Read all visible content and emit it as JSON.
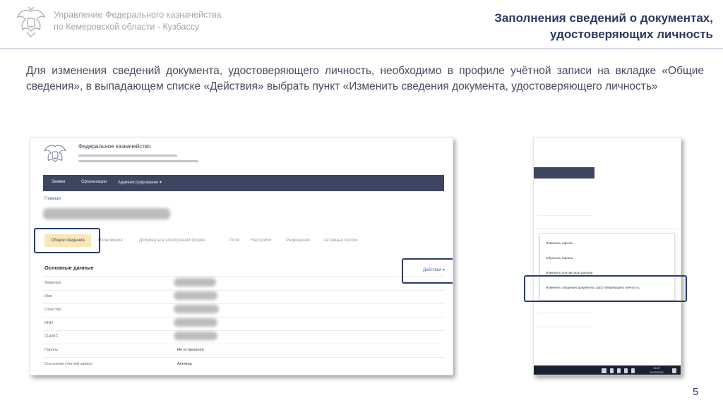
{
  "header": {
    "org_line1": "Управление Федерального казначейства",
    "org_line2": "по Кемеровской области - Кузбассу",
    "title_line1": "Заполнения сведений о документах,",
    "title_line2": "удостоверяющих личность"
  },
  "body_text": "Для изменения сведений документа, удостоверяющего личность, необходимо в профиле учётной записи на вкладке «Общие сведения», в выпадающем списке «Действия» выбрать пункт  «Изменить сведения документа, удостоверяющего личность»",
  "screenshot1": {
    "brand": "Федеральное казначейство",
    "nav": [
      "Заявки",
      "Организации",
      "Администрирование ▾"
    ],
    "breadcrumb": "Главная",
    "tabs": [
      "Общие сведения",
      "Полномочия",
      "Документы в электронной форме",
      "Роли",
      "Настройки",
      "Разрешения",
      "Активные сессии"
    ],
    "section_title": "Основные данные",
    "actions_label": "Действия ▾",
    "fields": [
      {
        "label": "Фамилия",
        "value": ""
      },
      {
        "label": "Имя",
        "value": ""
      },
      {
        "label": "Отчество",
        "value": ""
      },
      {
        "label": "ИНН",
        "value": ""
      },
      {
        "label": "СНИЛС",
        "value": ""
      },
      {
        "label": "Пароль",
        "value": "Не установлен"
      },
      {
        "label": "Состояние учетной записи",
        "value": "Активна"
      }
    ]
  },
  "screenshot2": {
    "menu_items": [
      "Изменить пароль",
      "Сбросить пароль",
      "Изменить контактные данные",
      "Изменить сведения документа, удостоверяющего личность"
    ],
    "taskbar_time": "10:47",
    "taskbar_date": "15.03.2021"
  },
  "page_number": "5",
  "colors": {
    "title": "#2a3a60",
    "navbar": "#3d4560",
    "highlight_border": "#2b3a6e",
    "active_tab": "#f6e8b8"
  }
}
